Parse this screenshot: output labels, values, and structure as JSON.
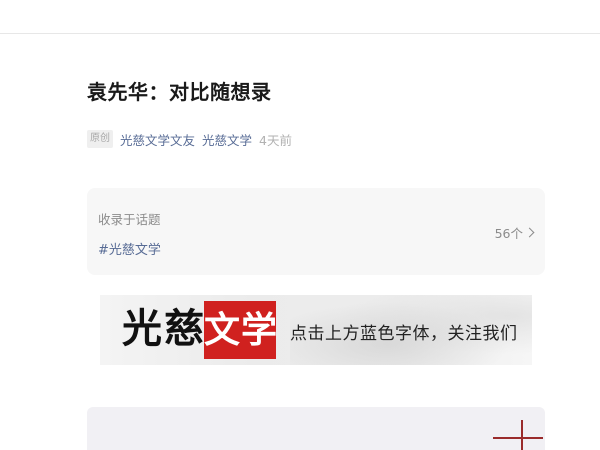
{
  "article": {
    "title": "袁先华：对比随想录",
    "original_tag": "原创",
    "author": "光慈文学文友",
    "account": "光慈文学",
    "time": "4天前"
  },
  "topic": {
    "label": "收录于话题",
    "hashtag": "#光慈文学",
    "count": "56个"
  },
  "banner": {
    "brand_black": "光慈",
    "brand_red": "文学",
    "slogan": "点击上方蓝色字体，关注我们",
    "brand_red_color": "#d0211f"
  }
}
